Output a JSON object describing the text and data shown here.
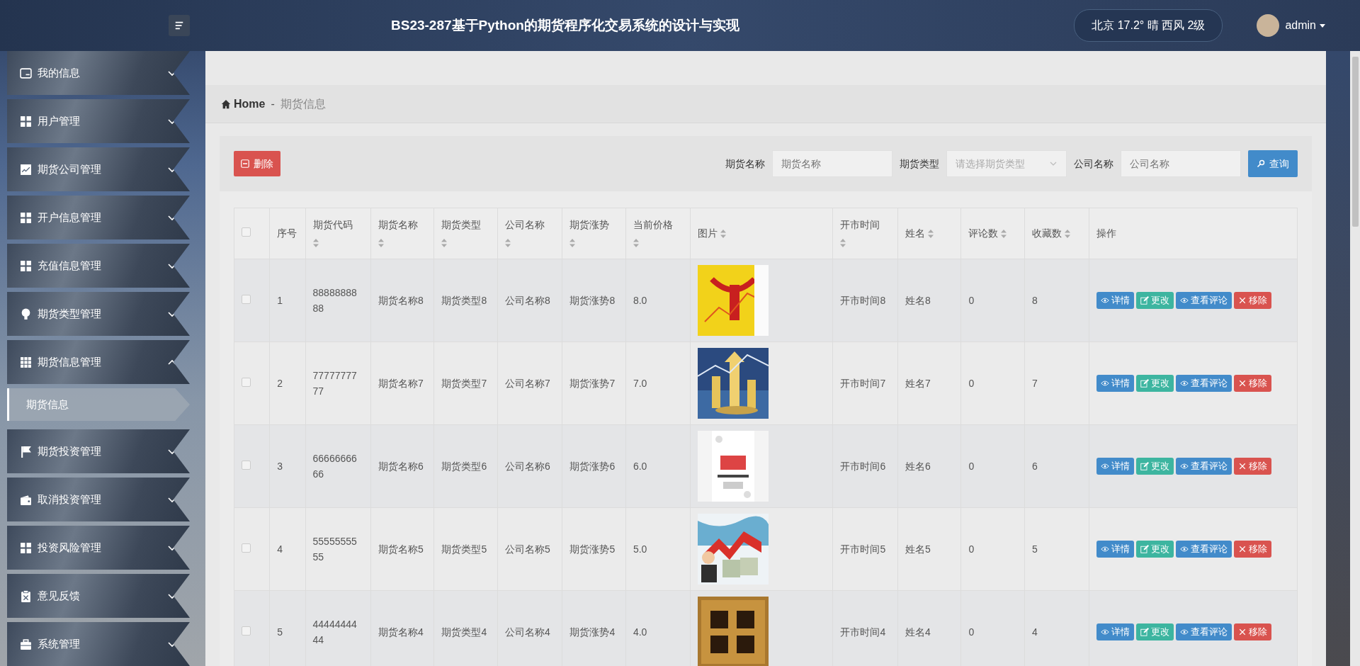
{
  "header": {
    "title": "BS23-287基于Python的期货程序化交易系统的设计与实现",
    "weather": "北京  17.2°  晴  西风  2级",
    "user": "admin"
  },
  "sidebar": {
    "items": [
      {
        "label": "我的信息",
        "expanded": false
      },
      {
        "label": "用户管理",
        "expanded": false
      },
      {
        "label": "期货公司管理",
        "expanded": false
      },
      {
        "label": "开户信息管理",
        "expanded": false
      },
      {
        "label": "充值信息管理",
        "expanded": false
      },
      {
        "label": "期货类型管理",
        "expanded": false
      },
      {
        "label": "期货信息管理",
        "expanded": true,
        "children": [
          {
            "label": "期货信息",
            "selected": true
          }
        ]
      },
      {
        "label": "期货投资管理",
        "expanded": false
      },
      {
        "label": "取消投资管理",
        "expanded": false
      },
      {
        "label": "投资风险管理",
        "expanded": false
      },
      {
        "label": "意见反馈",
        "expanded": false
      },
      {
        "label": "系统管理",
        "expanded": false
      }
    ]
  },
  "breadcrumb": {
    "home": "Home",
    "separator": "-",
    "current": "期货信息"
  },
  "toolbar": {
    "delete_button": "删除",
    "filters": [
      {
        "label": "期货名称",
        "kind": "text",
        "placeholder": "期货名称"
      },
      {
        "label": "期货类型",
        "kind": "select",
        "placeholder": "请选择期货类型"
      },
      {
        "label": "公司名称",
        "kind": "text",
        "placeholder": "公司名称"
      }
    ],
    "search_button": "查询"
  },
  "table": {
    "header_checked": false,
    "columns": [
      {
        "label": "序号",
        "sortable": false
      },
      {
        "label": "期货代码",
        "sortable": true
      },
      {
        "label": "期货名称",
        "sortable": true
      },
      {
        "label": "期货类型",
        "sortable": true
      },
      {
        "label": "公司名称",
        "sortable": true
      },
      {
        "label": "期货涨势",
        "sortable": true
      },
      {
        "label": "当前价格",
        "sortable": true
      },
      {
        "label": "图片",
        "sortable": true
      },
      {
        "label": "开市时间",
        "sortable": true
      },
      {
        "label": "姓名",
        "sortable": true
      },
      {
        "label": "评论数",
        "sortable": true
      },
      {
        "label": "收藏数",
        "sortable": true
      },
      {
        "label": "操作",
        "sortable": false
      }
    ],
    "rows": [
      {
        "checked": false,
        "cells": [
          "1",
          "8888888888",
          "期货名称8",
          "期货类型8",
          "公司名称8",
          "期货涨势8",
          "8.0"
        ],
        "image": {
          "kind": "picture"
        },
        "more": [
          "开市时间8",
          "姓名8",
          "0",
          "8"
        ],
        "actions": [
          {
            "label": "详情",
            "kind": "detail"
          },
          {
            "label": "更改",
            "kind": "edit"
          },
          {
            "label": "查看评论",
            "kind": "comments"
          },
          {
            "label": "移除",
            "kind": "remove"
          }
        ]
      },
      {
        "checked": false,
        "cells": [
          "2",
          "7777777777",
          "期货名称7",
          "期货类型7",
          "公司名称7",
          "期货涨势7",
          "7.0"
        ],
        "image": {
          "kind": "picture"
        },
        "more": [
          "开市时间7",
          "姓名7",
          "0",
          "7"
        ],
        "actions": [
          {
            "label": "详情",
            "kind": "detail"
          },
          {
            "label": "更改",
            "kind": "edit"
          },
          {
            "label": "查看评论",
            "kind": "comments"
          },
          {
            "label": "移除",
            "kind": "remove"
          }
        ]
      },
      {
        "checked": false,
        "cells": [
          "3",
          "6666666666",
          "期货名称6",
          "期货类型6",
          "公司名称6",
          "期货涨势6",
          "6.0"
        ],
        "image": {
          "kind": "picture"
        },
        "more": [
          "开市时间6",
          "姓名6",
          "0",
          "6"
        ],
        "actions": [
          {
            "label": "详情",
            "kind": "detail"
          },
          {
            "label": "更改",
            "kind": "edit"
          },
          {
            "label": "查看评论",
            "kind": "comments"
          },
          {
            "label": "移除",
            "kind": "remove"
          }
        ]
      },
      {
        "checked": false,
        "cells": [
          "4",
          "5555555555",
          "期货名称5",
          "期货类型5",
          "公司名称5",
          "期货涨势5",
          "5.0"
        ],
        "image": {
          "kind": "picture"
        },
        "more": [
          "开市时间5",
          "姓名5",
          "0",
          "5"
        ],
        "actions": [
          {
            "label": "详情",
            "kind": "detail"
          },
          {
            "label": "更改",
            "kind": "edit"
          },
          {
            "label": "查看评论",
            "kind": "comments"
          },
          {
            "label": "移除",
            "kind": "remove"
          }
        ]
      },
      {
        "checked": false,
        "cells": [
          "5",
          "4444444444",
          "期货名称4",
          "期货类型4",
          "公司名称4",
          "期货涨势4",
          "4.0"
        ],
        "image": {
          "kind": "picture"
        },
        "more": [
          "开市时间4",
          "姓名4",
          "0",
          "4"
        ],
        "actions": [
          {
            "label": "详情",
            "kind": "detail"
          },
          {
            "label": "更改",
            "kind": "edit"
          },
          {
            "label": "查看评论",
            "kind": "comments"
          },
          {
            "label": "移除",
            "kind": "remove"
          }
        ]
      }
    ]
  }
}
